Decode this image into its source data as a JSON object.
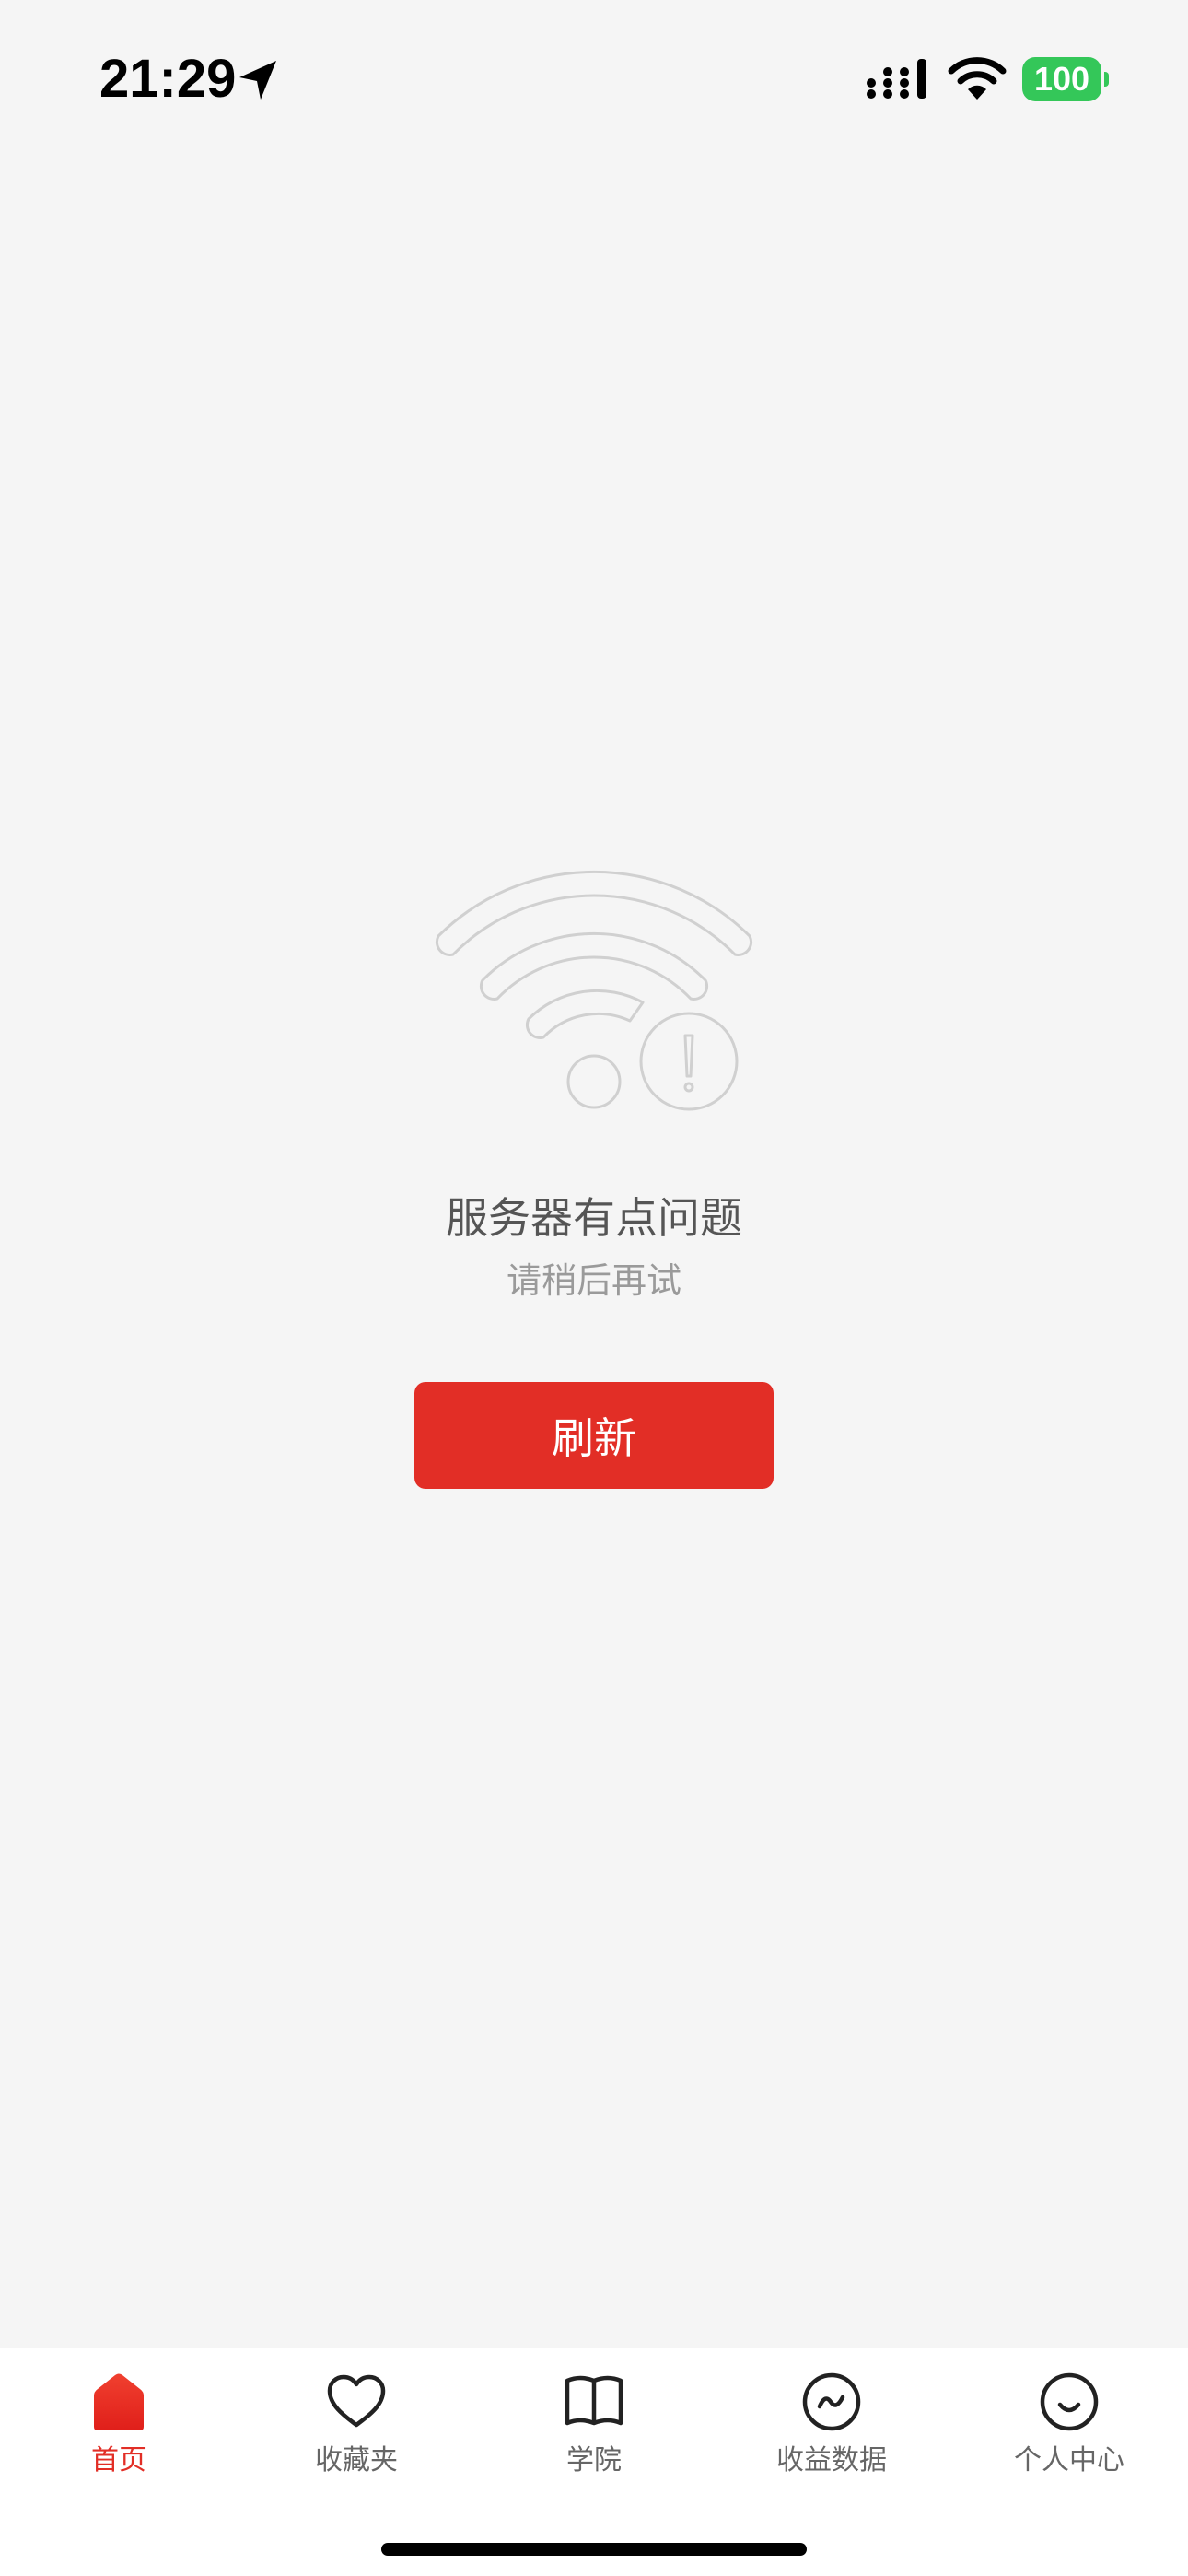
{
  "status_bar": {
    "time": "21:29",
    "battery": "100",
    "battery_color": "#34c759"
  },
  "error": {
    "icon": "wifi-error-icon",
    "title": "服务器有点问题",
    "subtitle": "请稍后再试",
    "button_label": "刷新"
  },
  "tabs": [
    {
      "label": "首页",
      "icon": "home-icon",
      "active": true
    },
    {
      "label": "收藏夹",
      "icon": "heart-icon",
      "active": false
    },
    {
      "label": "学院",
      "icon": "book-icon",
      "active": false
    },
    {
      "label": "收益数据",
      "icon": "chart-circle-icon",
      "active": false
    },
    {
      "label": "个人中心",
      "icon": "smile-icon",
      "active": false
    }
  ],
  "colors": {
    "accent": "#e22e26",
    "background": "#f5f5f5",
    "tab_inactive": "#666666"
  }
}
